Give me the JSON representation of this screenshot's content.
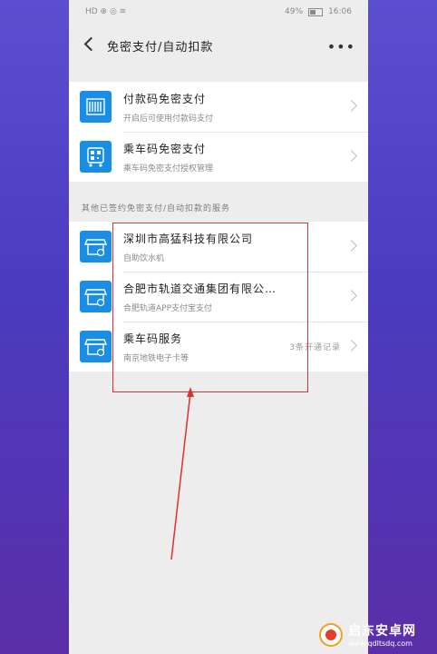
{
  "status_bar": {
    "left": "HD ⊕ ◎ ≋",
    "battery": "49%",
    "time": "16:06"
  },
  "header": {
    "title": "免密支付/自动扣款",
    "more": "•••"
  },
  "group1": [
    {
      "title": "付款码免密支付",
      "subtitle": "开启后可使用付款码支付"
    },
    {
      "title": "乘车码免密支付",
      "subtitle": "乘车码免密支付授权管理"
    }
  ],
  "section_label": "其他已签约免密支付/自动扣款的服务",
  "group2": [
    {
      "title": "深圳市高猛科技有限公司",
      "subtitle": "自助饮水机",
      "extra": ""
    },
    {
      "title": "合肥市轨道交通集团有限公…",
      "subtitle": "合肥轨道APP支付宝支付",
      "extra": ""
    },
    {
      "title": "乘车码服务",
      "subtitle": "南京地铁电子卡等",
      "extra": "3条开通记录"
    }
  ],
  "watermark": {
    "name": "启东安卓网",
    "url": "www.qdltsdq.com"
  },
  "colors": {
    "accent": "#1a8ee5",
    "annotation": "#e0302b"
  }
}
